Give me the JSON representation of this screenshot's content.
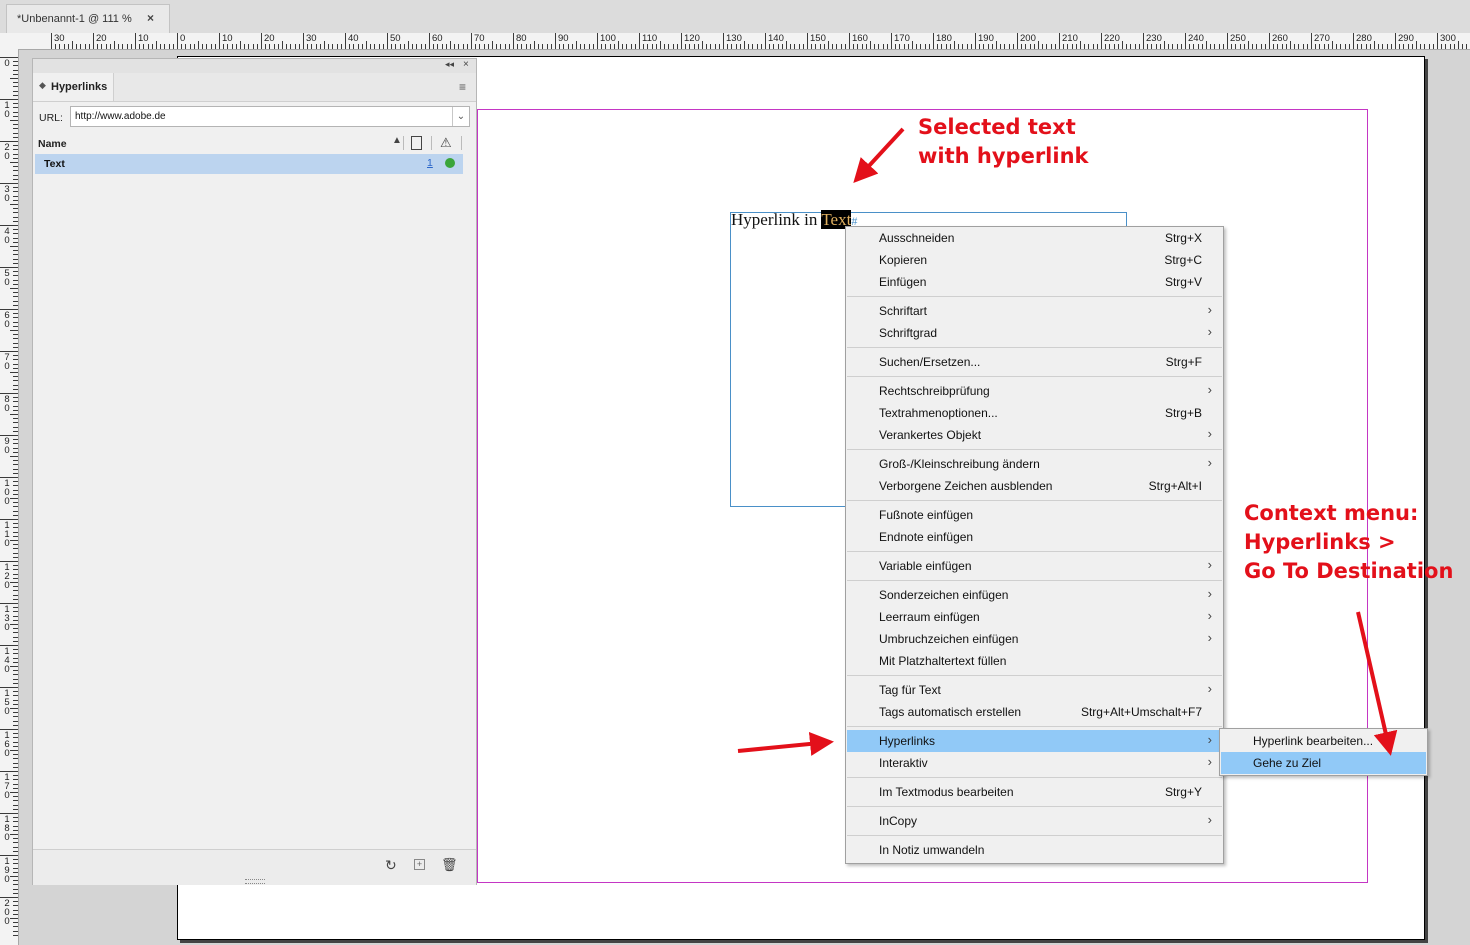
{
  "tab": {
    "title": "*Unbenannt-1 @ 111 %",
    "close": "×"
  },
  "ruler": {
    "h_labels": [
      "30",
      "20",
      "10",
      "0",
      "10",
      "20",
      "30",
      "40",
      "50",
      "60",
      "70",
      "80",
      "90",
      "100",
      "110",
      "120",
      "130",
      "140",
      "150",
      "160",
      "170",
      "180",
      "190",
      "200",
      "210",
      "220",
      "230",
      "240",
      "250",
      "260",
      "270",
      "280",
      "290",
      "300"
    ],
    "v_labels": [
      "0",
      "1 0",
      "2 0",
      "3 0",
      "4 0",
      "5 0",
      "6 0",
      "7 0",
      "8 0",
      "9 0",
      "1 0 0",
      "1 1 0",
      "1 2 0",
      "1 3 0",
      "1 4 0",
      "1 5 0",
      "1 6 0",
      "1 7 0",
      "1 8 0",
      "1 9 0",
      "2 0 0"
    ]
  },
  "panel": {
    "title": "Hyperlinks",
    "url_label": "URL:",
    "url_value": "http://www.adobe.de",
    "col_name": "Name",
    "row": {
      "name": "Text",
      "page": "1"
    },
    "collapse": "◂◂",
    "close": "×",
    "menu": "≡"
  },
  "document": {
    "text_before": "Hyperlink in ",
    "text_selected": "Text",
    "text_marker": "#"
  },
  "context_menu": [
    [
      {
        "label": "Ausschneiden",
        "shortcut": "Strg+X"
      },
      {
        "label": "Kopieren",
        "shortcut": "Strg+C"
      },
      {
        "label": "Einfügen",
        "shortcut": "Strg+V"
      }
    ],
    [
      {
        "label": "Schriftart",
        "submenu": true
      },
      {
        "label": "Schriftgrad",
        "submenu": true
      }
    ],
    [
      {
        "label": "Suchen/Ersetzen...",
        "shortcut": "Strg+F"
      }
    ],
    [
      {
        "label": "Rechtschreibprüfung",
        "submenu": true
      },
      {
        "label": "Textrahmenoptionen...",
        "shortcut": "Strg+B"
      },
      {
        "label": "Verankertes Objekt",
        "submenu": true
      }
    ],
    [
      {
        "label": "Groß-/Kleinschreibung ändern",
        "submenu": true
      },
      {
        "label": "Verborgene Zeichen ausblenden",
        "shortcut": "Strg+Alt+I"
      }
    ],
    [
      {
        "label": "Fußnote einfügen"
      },
      {
        "label": "Endnote einfügen"
      }
    ],
    [
      {
        "label": "Variable einfügen",
        "submenu": true
      }
    ],
    [
      {
        "label": "Sonderzeichen einfügen",
        "submenu": true
      },
      {
        "label": "Leerraum einfügen",
        "submenu": true
      },
      {
        "label": "Umbruchzeichen einfügen",
        "submenu": true
      },
      {
        "label": "Mit Platzhaltertext füllen"
      }
    ],
    [
      {
        "label": "Tag für Text",
        "submenu": true
      },
      {
        "label": "Tags automatisch erstellen",
        "shortcut": "Strg+Alt+Umschalt+F7"
      }
    ],
    [
      {
        "label": "Hyperlinks",
        "submenu": true,
        "highlighted": true
      },
      {
        "label": "Interaktiv",
        "submenu": true
      }
    ],
    [
      {
        "label": "Im Textmodus bearbeiten",
        "shortcut": "Strg+Y"
      }
    ],
    [
      {
        "label": "InCopy",
        "submenu": true
      }
    ],
    [
      {
        "label": "In Notiz umwandeln"
      }
    ]
  ],
  "submenu": [
    {
      "label": "Hyperlink bearbeiten..."
    },
    {
      "label": "Gehe zu Ziel",
      "highlighted": true
    }
  ],
  "annotations": {
    "selected_line1": "Selected text",
    "selected_line2": "with hyperlink",
    "context_line1": "Context menu:",
    "context_line2": "Hyperlinks >",
    "context_line3": "Go To Destination"
  },
  "colors": {
    "annotation": "#e3101a",
    "highlight": "#91c9f7",
    "selection_row": "#bcd4ef",
    "margin_guide": "#c436c4",
    "frame": "#4a90c8",
    "status_dot": "#3aa53a"
  }
}
